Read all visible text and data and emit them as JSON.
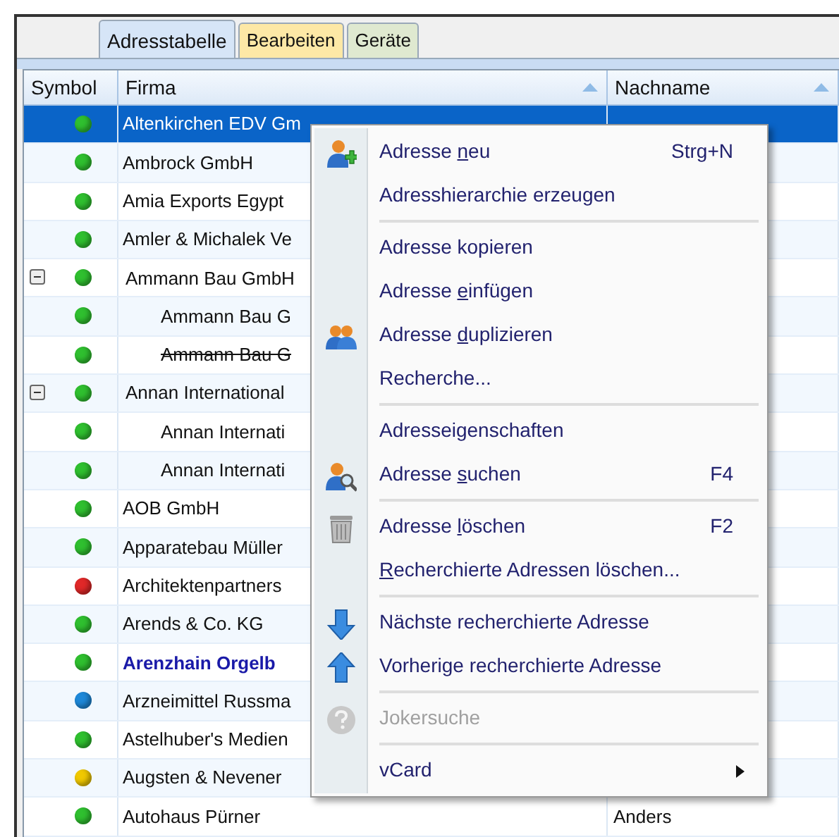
{
  "tabs": [
    {
      "label": "Adresstabelle",
      "selected": true,
      "color": "#d6e5f7"
    },
    {
      "label": "Bearbeiten",
      "selected": false,
      "color": "#fde8a6"
    },
    {
      "label": "Geräte",
      "selected": false,
      "color": "#dfe9d0"
    }
  ],
  "table": {
    "columns": [
      {
        "label": "Symbol",
        "sorted": false
      },
      {
        "label": "Firma",
        "sorted": true
      },
      {
        "label": "Nachname",
        "sorted": true
      }
    ],
    "rows": [
      {
        "firma": "Altenkirchen EDV Gm",
        "color": "#2fbf2f",
        "selected": true,
        "struck": false,
        "emphasized": false
      },
      {
        "firma": "Ambrock GmbH",
        "color": "#2fbf2f",
        "selected": false,
        "struck": false,
        "emphasized": false
      },
      {
        "firma": "Amia Exports Egypt",
        "color": "#2fbf2f",
        "selected": false,
        "struck": false,
        "emphasized": false
      },
      {
        "firma": "Amler & Michalek Ve",
        "color": "#2fbf2f",
        "selected": false,
        "struck": false,
        "emphasized": false
      },
      {
        "firma": "Ammann Bau GmbH",
        "color": "#2fbf2f",
        "selected": false,
        "struck": false,
        "emphasized": false,
        "expanded": true,
        "children": [
          {
            "firma": "Ammann Bau G",
            "color": "#2fbf2f",
            "selected": false,
            "struck": false,
            "emphasized": false
          },
          {
            "firma": "Ammann Bau G",
            "color": "#2fbf2f",
            "selected": false,
            "struck": true,
            "emphasized": false
          }
        ]
      },
      {
        "firma": "Annan International",
        "color": "#2fbf2f",
        "selected": false,
        "struck": false,
        "emphasized": false,
        "expanded": true,
        "children": [
          {
            "firma": "Annan Internati",
            "color": "#2fbf2f",
            "selected": false,
            "struck": false,
            "emphasized": false
          },
          {
            "firma": "Annan Internati",
            "color": "#2fbf2f",
            "selected": false,
            "struck": false,
            "emphasized": false
          }
        ]
      },
      {
        "firma": "AOB GmbH",
        "color": "#2fbf2f",
        "selected": false,
        "struck": false,
        "emphasized": false
      },
      {
        "firma": "Apparatebau Müller",
        "color": "#2fbf2f",
        "selected": false,
        "struck": false,
        "emphasized": false
      },
      {
        "firma": "Architektenpartners",
        "color": "#e02828",
        "selected": false,
        "struck": false,
        "emphasized": false
      },
      {
        "firma": "Arends & Co. KG",
        "color": "#2fbf2f",
        "selected": false,
        "struck": false,
        "emphasized": false
      },
      {
        "firma": "Arenzhain Orgelb",
        "color": "#2fbf2f",
        "selected": false,
        "struck": false,
        "emphasized": true
      },
      {
        "firma": "Arzneimittel Russma",
        "color": "#1e88d8",
        "selected": false,
        "struck": false,
        "emphasized": false
      },
      {
        "firma": "Astelhuber's Medien",
        "color": "#2fbf2f",
        "selected": false,
        "struck": false,
        "emphasized": false
      },
      {
        "firma": "Augsten & Nevener",
        "color": "#f0c800",
        "selected": false,
        "struck": false,
        "emphasized": false
      },
      {
        "firma": "Autohaus Pürner",
        "nachname": "Anders",
        "color": "#2fbf2f",
        "selected": false,
        "struck": false,
        "emphasized": false
      }
    ]
  },
  "context_menu": {
    "items": [
      {
        "kind": "item",
        "label_before": "Adresse ",
        "access_key": "n",
        "label_after": "eu",
        "shortcut": "Strg+N",
        "disabled": false
      },
      {
        "kind": "item",
        "label_before": "Adresshierarchie erzeugen",
        "disabled": false
      },
      {
        "kind": "separator"
      },
      {
        "kind": "item",
        "label_before": "Adresse kopieren",
        "disabled": false
      },
      {
        "kind": "item",
        "label_before": "Adresse ",
        "access_key": "e",
        "label_after": "infügen",
        "disabled": false
      },
      {
        "kind": "item",
        "label_before": "Adresse ",
        "access_key": "d",
        "label_after": "uplizieren",
        "disabled": false
      },
      {
        "kind": "item",
        "label_before": "Recherche...",
        "disabled": false
      },
      {
        "kind": "separator"
      },
      {
        "kind": "item",
        "label_before": "Adresseigenschaften",
        "disabled": false
      },
      {
        "kind": "item",
        "label_before": "Adresse ",
        "access_key": "s",
        "label_after": "uchen",
        "shortcut": "F4",
        "disabled": false
      },
      {
        "kind": "separator"
      },
      {
        "kind": "item",
        "label_before": "Adresse ",
        "access_key": "l",
        "label_after": "öschen",
        "shortcut": "F2",
        "disabled": false
      },
      {
        "kind": "item",
        "access_key": "R",
        "label_after": "echerchierte Adressen löschen...",
        "disabled": false
      },
      {
        "kind": "separator"
      },
      {
        "kind": "item",
        "label_before": "Nächste recherchierte Adresse",
        "disabled": false
      },
      {
        "kind": "item",
        "label_before": "Vorherige recherchierte Adresse",
        "disabled": false
      },
      {
        "kind": "separator"
      },
      {
        "kind": "item",
        "label_before": "Jokersuche",
        "disabled": true
      },
      {
        "kind": "separator"
      },
      {
        "kind": "item",
        "label_before": "vCard",
        "submenu": true,
        "disabled": false
      }
    ]
  }
}
